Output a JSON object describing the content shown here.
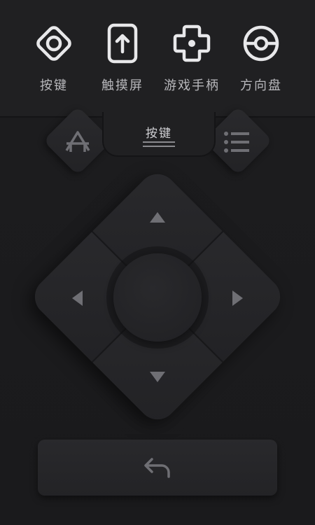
{
  "modes": [
    {
      "label": "按键",
      "icon": "diamond-key-icon"
    },
    {
      "label": "触摸屏",
      "icon": "touchscreen-icon"
    },
    {
      "label": "游戏手柄",
      "icon": "gamepad-icon"
    },
    {
      "label": "方向盘",
      "icon": "steering-wheel-icon"
    }
  ],
  "tab": {
    "label": "按键"
  },
  "icons": {
    "home": "home-icon",
    "menu": "menu-icon",
    "back": "back-arrow-icon"
  },
  "colors": {
    "background": "#1b1b1d",
    "panel": "#202022",
    "icon": "#e8e8ea",
    "arrow": "#6f6f74",
    "label": "#b8b8bc"
  }
}
